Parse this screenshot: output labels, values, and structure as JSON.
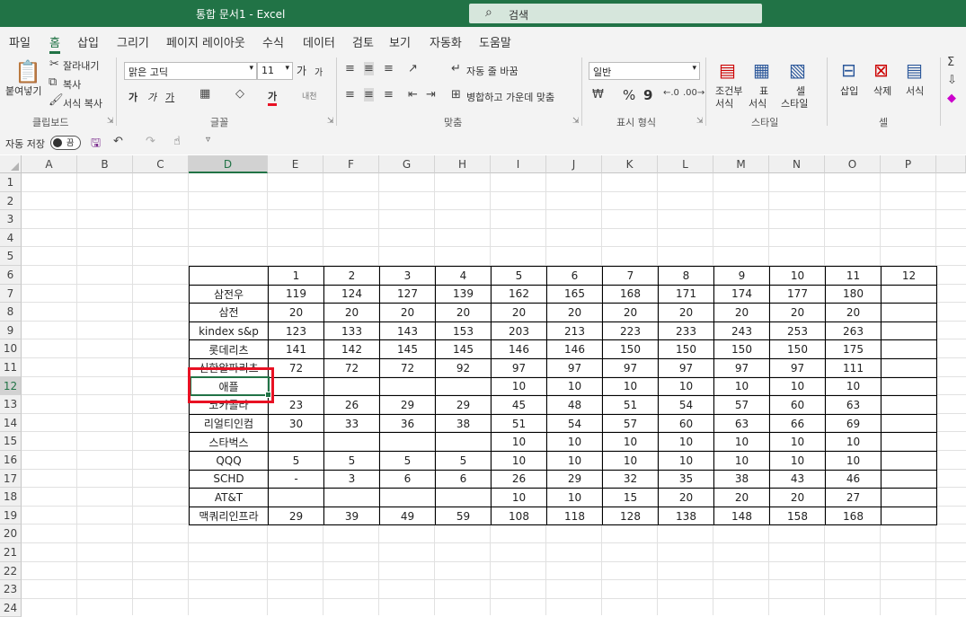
{
  "window": {
    "title": "통합 문서1  -  Excel",
    "search_placeholder": "검색"
  },
  "tabs": [
    "파일",
    "홈",
    "삽입",
    "그리기",
    "페이지 레이아웃",
    "수식",
    "데이터",
    "검토",
    "보기",
    "자동화",
    "도움말"
  ],
  "active_tab": "홈",
  "ribbon": {
    "clipboard": {
      "paste": "붙여넣기",
      "cut": "잘라내기",
      "copy": "복사",
      "format_painter": "서식 복사",
      "group": "클립보드"
    },
    "font": {
      "name": "맑은 고딕",
      "size": "11",
      "grow": "가",
      "shrink": "가",
      "bold": "가",
      "italic": "가",
      "underline": "가",
      "font_color_glyph": "가",
      "phonetic": "내천",
      "group": "글꼴"
    },
    "alignment": {
      "wrap_text": "자동 줄 바꿈",
      "merge_center": "병합하고 가운데 맞춤",
      "group": "맞춤"
    },
    "number": {
      "format": "일반",
      "percent": "%",
      "comma": "9",
      "group": "표시 형식"
    },
    "styles": {
      "conditional": "조건부",
      "conditional2": "서식",
      "table": "표",
      "table2": "서식",
      "cell": "셀",
      "cell2": "스타일",
      "group": "스타일"
    },
    "cells": {
      "insert": "삽입",
      "delete": "삭제",
      "format": "서식",
      "group": "셀"
    }
  },
  "qat": {
    "autosave": "자동 저장",
    "toggle": "끔"
  },
  "columns": [
    "A",
    "B",
    "C",
    "D",
    "E",
    "F",
    "G",
    "H",
    "I",
    "J",
    "K",
    "L",
    "M",
    "N",
    "O",
    "P"
  ],
  "selected_column": "D",
  "rows": [
    "1",
    "2",
    "3",
    "4",
    "5",
    "6",
    "7",
    "8",
    "9",
    "10",
    "11",
    "12",
    "13",
    "14",
    "15",
    "16",
    "17",
    "18",
    "19",
    "20",
    "21",
    "22",
    "23",
    "24"
  ],
  "selected_row": "12",
  "table": {
    "header": [
      "",
      "1",
      "2",
      "3",
      "4",
      "5",
      "6",
      "7",
      "8",
      "9",
      "10",
      "11",
      "12"
    ],
    "rows": [
      [
        "삼전우",
        "119",
        "124",
        "127",
        "139",
        "162",
        "165",
        "168",
        "171",
        "174",
        "177",
        "180",
        ""
      ],
      [
        "삼전",
        "20",
        "20",
        "20",
        "20",
        "20",
        "20",
        "20",
        "20",
        "20",
        "20",
        "20",
        ""
      ],
      [
        "kindex s&p",
        "123",
        "133",
        "143",
        "153",
        "203",
        "213",
        "223",
        "233",
        "243",
        "253",
        "263",
        ""
      ],
      [
        "롯데리츠",
        "141",
        "142",
        "145",
        "145",
        "146",
        "146",
        "150",
        "150",
        "150",
        "150",
        "175",
        ""
      ],
      [
        "신한알파리츠",
        "72",
        "72",
        "72",
        "92",
        "97",
        "97",
        "97",
        "97",
        "97",
        "97",
        "111",
        ""
      ],
      [
        "애플",
        "",
        "",
        "",
        "",
        "10",
        "10",
        "10",
        "10",
        "10",
        "10",
        "10",
        ""
      ],
      [
        "코카콜라",
        "23",
        "26",
        "29",
        "29",
        "45",
        "48",
        "51",
        "54",
        "57",
        "60",
        "63",
        ""
      ],
      [
        "리얼티인컴",
        "30",
        "33",
        "36",
        "38",
        "51",
        "54",
        "57",
        "60",
        "63",
        "66",
        "69",
        ""
      ],
      [
        "스타벅스",
        "",
        "",
        "",
        "",
        "10",
        "10",
        "10",
        "10",
        "10",
        "10",
        "10",
        ""
      ],
      [
        "QQQ",
        "5",
        "5",
        "5",
        "5",
        "10",
        "10",
        "10",
        "10",
        "10",
        "10",
        "10",
        ""
      ],
      [
        "SCHD",
        "-",
        "3",
        "6",
        "6",
        "26",
        "29",
        "32",
        "35",
        "38",
        "43",
        "46",
        ""
      ],
      [
        "AT&T",
        "",
        "",
        "",
        "",
        "10",
        "10",
        "15",
        "20",
        "20",
        "20",
        "27",
        ""
      ],
      [
        "맥쿼리인프라",
        "29",
        "39",
        "49",
        "59",
        "108",
        "118",
        "128",
        "138",
        "148",
        "158",
        "168",
        ""
      ]
    ]
  }
}
